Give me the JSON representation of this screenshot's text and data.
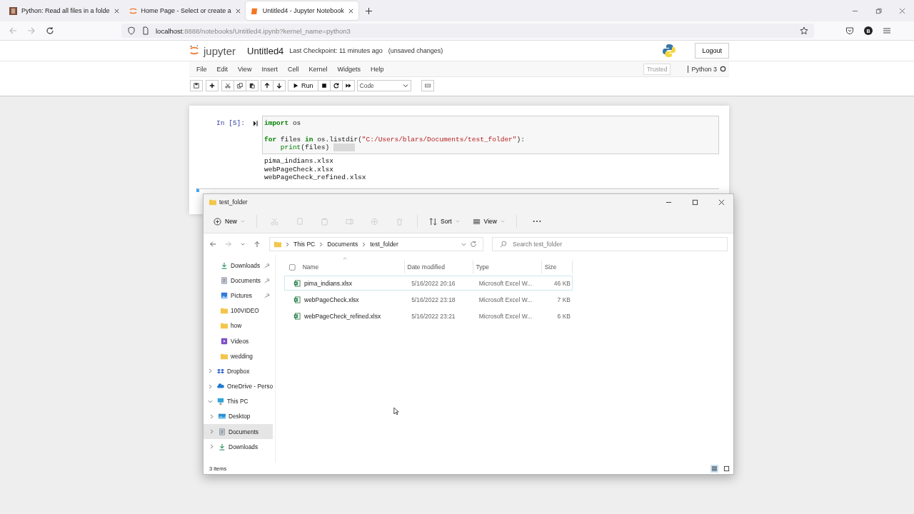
{
  "browser": {
    "tabs": [
      {
        "title": "Python: Read all files in a folde",
        "selected": false
      },
      {
        "title": "Home Page - Select or create a",
        "selected": false
      },
      {
        "title": "Untitled4 - Jupyter Notebook",
        "selected": true
      }
    ],
    "url": {
      "host": "localhost",
      "rest": ":8888/notebooks/Untitled4.ipynb?kernel_name=python3"
    },
    "profile_initial": "B"
  },
  "jupyter": {
    "logo": "jupyter",
    "notebook_name": "Untitled4",
    "checkpoint": "Last Checkpoint: 11 minutes ago",
    "save_status": "(unsaved changes)",
    "logout": "Logout",
    "menu": [
      "File",
      "Edit",
      "View",
      "Insert",
      "Cell",
      "Kernel",
      "Widgets",
      "Help"
    ],
    "trusted": "Trusted",
    "kernel": "Python 3",
    "run": "Run",
    "cell_type": "Code",
    "cell": {
      "prompt": "In [5]:",
      "code": [
        {
          "gap_before": false,
          "selection_after": false,
          "indented": false,
          "tokens": [
            {
              "kind": "keyword",
              "text": "import"
            },
            {
              "kind": "plain",
              "text": " os"
            }
          ]
        },
        {
          "gap_before": true,
          "selection_after": false,
          "indented": false,
          "tokens": [
            {
              "kind": "keyword",
              "text": "for"
            },
            {
              "kind": "plain",
              "text": " files "
            },
            {
              "kind": "keyword",
              "text": "in"
            },
            {
              "kind": "plain",
              "text": " os.listdir("
            },
            {
              "kind": "string",
              "text": "\"C:/Users/blars/Documents/test_folder\""
            },
            {
              "kind": "plain",
              "text": "):"
            }
          ]
        },
        {
          "gap_before": false,
          "selection_after": true,
          "indented": true,
          "tokens": [
            {
              "kind": "builtin",
              "text": "print"
            },
            {
              "kind": "plain",
              "text": "(files)"
            }
          ]
        }
      ],
      "output": [
        "pima_indians.xlsx",
        "webPageCheck.xlsx",
        "webPageCheck_refined.xlsx"
      ]
    }
  },
  "explorer": {
    "title": "test_folder",
    "new": "New",
    "sort": "Sort",
    "view": "View",
    "breadcrumb": [
      "This PC",
      "Documents",
      "test_folder"
    ],
    "search": {
      "placeholder": "Search test_folder"
    },
    "quick_access": [
      {
        "label": "Downloads",
        "pinned": true
      },
      {
        "label": "Documents",
        "pinned": true
      },
      {
        "label": "Pictures",
        "pinned": true
      },
      {
        "label": "100VIDEO",
        "pinned": false
      },
      {
        "label": "how",
        "pinned": false
      },
      {
        "label": "Videos",
        "pinned": false
      },
      {
        "label": "wedding",
        "pinned": false
      }
    ],
    "tree": [
      {
        "label": "Dropbox",
        "expanded": false,
        "selected": false
      },
      {
        "label": "OneDrive - Perso",
        "expanded": false,
        "selected": false
      },
      {
        "label": "This PC",
        "expanded": true,
        "selected": false,
        "children": [
          {
            "label": "Desktop",
            "expanded": false,
            "selected": false
          },
          {
            "label": "Documents",
            "expanded": false,
            "selected": true
          },
          {
            "label": "Downloads",
            "expanded": false,
            "selected": false
          }
        ]
      }
    ],
    "columns": [
      "Name",
      "Date modified",
      "Type",
      "Size"
    ],
    "rows": [
      {
        "name": "pima_indians.xlsx",
        "date": "5/16/2022 20:16",
        "type": "Microsoft Excel W...",
        "size": "46 KB",
        "selected": true
      },
      {
        "name": "webPageCheck.xlsx",
        "date": "5/16/2022 23:18",
        "type": "Microsoft Excel W...",
        "size": "7 KB",
        "selected": false
      },
      {
        "name": "webPageCheck_refined.xlsx",
        "date": "5/16/2022 23:21",
        "type": "Microsoft Excel W...",
        "size": "6 KB",
        "selected": false
      }
    ],
    "status": "3 items"
  }
}
